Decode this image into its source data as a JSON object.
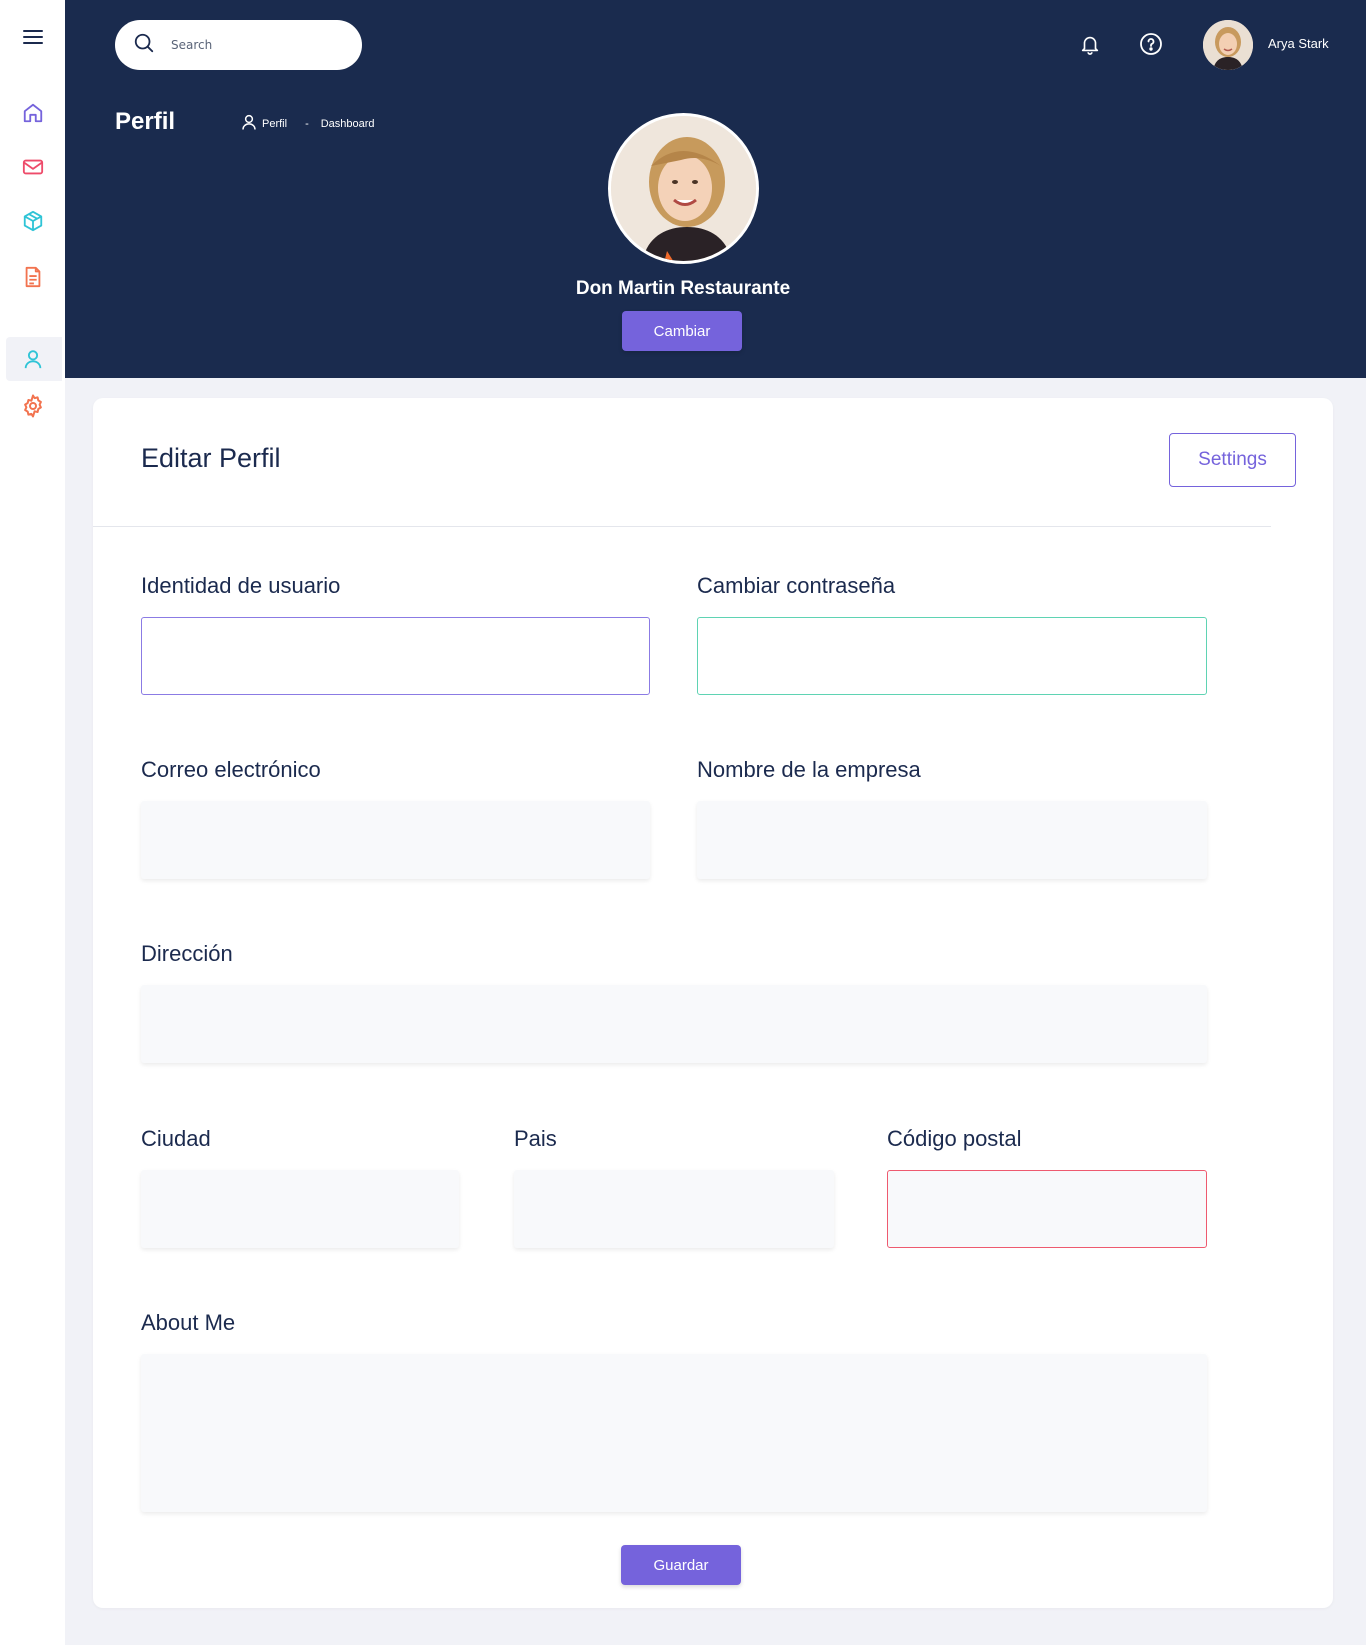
{
  "sidebar": {
    "items": [
      {
        "icon": "home-icon",
        "color": "#7563dc"
      },
      {
        "icon": "mail-icon",
        "color": "#ee4b6a"
      },
      {
        "icon": "box-icon",
        "color": "#2fc4d6"
      },
      {
        "icon": "document-icon",
        "color": "#f2734f"
      },
      {
        "icon": "user-icon",
        "color": "#2fc4d6",
        "active": true
      },
      {
        "icon": "gear-icon",
        "color": "#f2734f"
      }
    ]
  },
  "header": {
    "search_placeholder": "Search",
    "username": "Arya Stark",
    "page_title": "Perfil",
    "breadcrumb": {
      "current": "Perfil",
      "separator": "-",
      "parent": "Dashboard"
    },
    "profile_name": "Don Martin Restaurante",
    "change_button": "Cambiar"
  },
  "form": {
    "title": "Editar Perfil",
    "settings_button": "Settings",
    "fields": {
      "username": {
        "label": "Identidad de usuario",
        "value": ""
      },
      "password": {
        "label": "Cambiar contraseña",
        "value": ""
      },
      "email": {
        "label": "Correo electrónico",
        "value": ""
      },
      "company": {
        "label": "Nombre de la empresa",
        "value": ""
      },
      "address": {
        "label": "Dirección",
        "value": ""
      },
      "city": {
        "label": "Ciudad",
        "value": ""
      },
      "country": {
        "label": "Pais",
        "value": ""
      },
      "postal": {
        "label": "Código postal",
        "value": ""
      },
      "about": {
        "label": "About Me",
        "value": ""
      }
    },
    "save_button": "Guardar"
  },
  "colors": {
    "header_bg": "#1a2b4e",
    "accent": "#7563dc",
    "page_bg": "#f1f2f7",
    "error": "#ee5a6f",
    "success": "#5fd3b3"
  }
}
